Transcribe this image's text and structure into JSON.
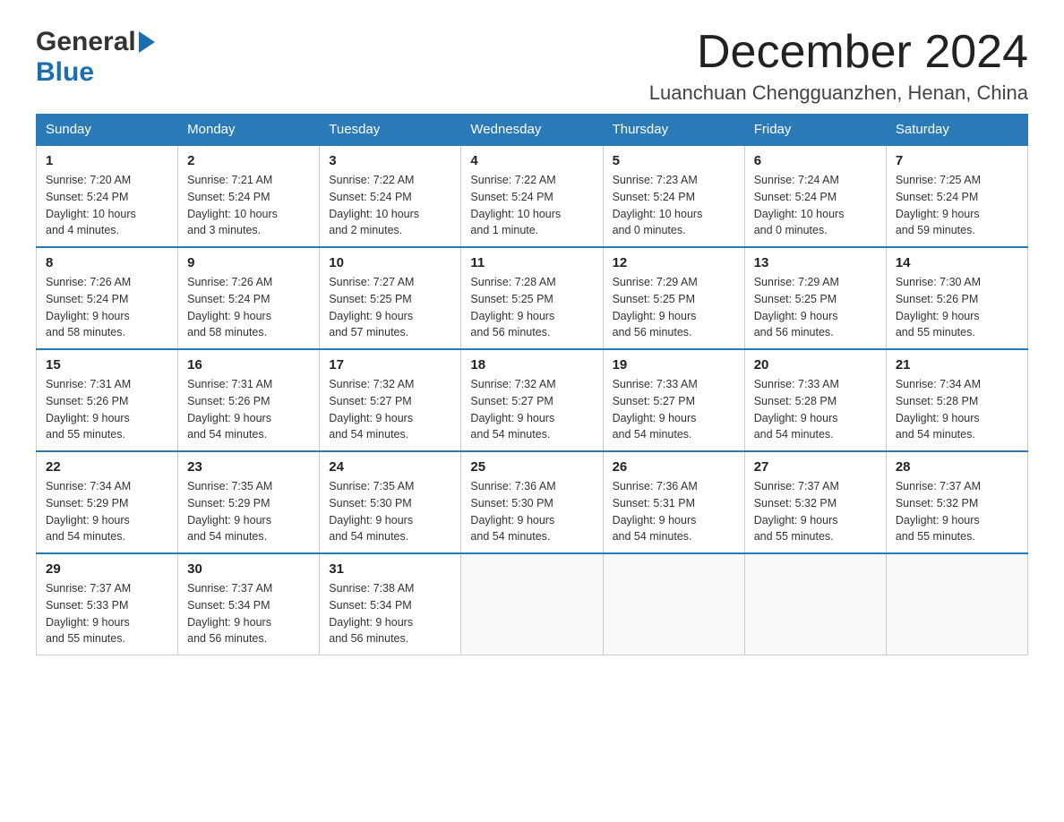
{
  "logo": {
    "general": "General",
    "blue": "Blue"
  },
  "header": {
    "month": "December 2024",
    "location": "Luanchuan Chengguanzhen, Henan, China"
  },
  "weekdays": [
    "Sunday",
    "Monday",
    "Tuesday",
    "Wednesday",
    "Thursday",
    "Friday",
    "Saturday"
  ],
  "weeks": [
    [
      {
        "day": "1",
        "info": "Sunrise: 7:20 AM\nSunset: 5:24 PM\nDaylight: 10 hours\nand 4 minutes."
      },
      {
        "day": "2",
        "info": "Sunrise: 7:21 AM\nSunset: 5:24 PM\nDaylight: 10 hours\nand 3 minutes."
      },
      {
        "day": "3",
        "info": "Sunrise: 7:22 AM\nSunset: 5:24 PM\nDaylight: 10 hours\nand 2 minutes."
      },
      {
        "day": "4",
        "info": "Sunrise: 7:22 AM\nSunset: 5:24 PM\nDaylight: 10 hours\nand 1 minute."
      },
      {
        "day": "5",
        "info": "Sunrise: 7:23 AM\nSunset: 5:24 PM\nDaylight: 10 hours\nand 0 minutes."
      },
      {
        "day": "6",
        "info": "Sunrise: 7:24 AM\nSunset: 5:24 PM\nDaylight: 10 hours\nand 0 minutes."
      },
      {
        "day": "7",
        "info": "Sunrise: 7:25 AM\nSunset: 5:24 PM\nDaylight: 9 hours\nand 59 minutes."
      }
    ],
    [
      {
        "day": "8",
        "info": "Sunrise: 7:26 AM\nSunset: 5:24 PM\nDaylight: 9 hours\nand 58 minutes."
      },
      {
        "day": "9",
        "info": "Sunrise: 7:26 AM\nSunset: 5:24 PM\nDaylight: 9 hours\nand 58 minutes."
      },
      {
        "day": "10",
        "info": "Sunrise: 7:27 AM\nSunset: 5:25 PM\nDaylight: 9 hours\nand 57 minutes."
      },
      {
        "day": "11",
        "info": "Sunrise: 7:28 AM\nSunset: 5:25 PM\nDaylight: 9 hours\nand 56 minutes."
      },
      {
        "day": "12",
        "info": "Sunrise: 7:29 AM\nSunset: 5:25 PM\nDaylight: 9 hours\nand 56 minutes."
      },
      {
        "day": "13",
        "info": "Sunrise: 7:29 AM\nSunset: 5:25 PM\nDaylight: 9 hours\nand 56 minutes."
      },
      {
        "day": "14",
        "info": "Sunrise: 7:30 AM\nSunset: 5:26 PM\nDaylight: 9 hours\nand 55 minutes."
      }
    ],
    [
      {
        "day": "15",
        "info": "Sunrise: 7:31 AM\nSunset: 5:26 PM\nDaylight: 9 hours\nand 55 minutes."
      },
      {
        "day": "16",
        "info": "Sunrise: 7:31 AM\nSunset: 5:26 PM\nDaylight: 9 hours\nand 54 minutes."
      },
      {
        "day": "17",
        "info": "Sunrise: 7:32 AM\nSunset: 5:27 PM\nDaylight: 9 hours\nand 54 minutes."
      },
      {
        "day": "18",
        "info": "Sunrise: 7:32 AM\nSunset: 5:27 PM\nDaylight: 9 hours\nand 54 minutes."
      },
      {
        "day": "19",
        "info": "Sunrise: 7:33 AM\nSunset: 5:27 PM\nDaylight: 9 hours\nand 54 minutes."
      },
      {
        "day": "20",
        "info": "Sunrise: 7:33 AM\nSunset: 5:28 PM\nDaylight: 9 hours\nand 54 minutes."
      },
      {
        "day": "21",
        "info": "Sunrise: 7:34 AM\nSunset: 5:28 PM\nDaylight: 9 hours\nand 54 minutes."
      }
    ],
    [
      {
        "day": "22",
        "info": "Sunrise: 7:34 AM\nSunset: 5:29 PM\nDaylight: 9 hours\nand 54 minutes."
      },
      {
        "day": "23",
        "info": "Sunrise: 7:35 AM\nSunset: 5:29 PM\nDaylight: 9 hours\nand 54 minutes."
      },
      {
        "day": "24",
        "info": "Sunrise: 7:35 AM\nSunset: 5:30 PM\nDaylight: 9 hours\nand 54 minutes."
      },
      {
        "day": "25",
        "info": "Sunrise: 7:36 AM\nSunset: 5:30 PM\nDaylight: 9 hours\nand 54 minutes."
      },
      {
        "day": "26",
        "info": "Sunrise: 7:36 AM\nSunset: 5:31 PM\nDaylight: 9 hours\nand 54 minutes."
      },
      {
        "day": "27",
        "info": "Sunrise: 7:37 AM\nSunset: 5:32 PM\nDaylight: 9 hours\nand 55 minutes."
      },
      {
        "day": "28",
        "info": "Sunrise: 7:37 AM\nSunset: 5:32 PM\nDaylight: 9 hours\nand 55 minutes."
      }
    ],
    [
      {
        "day": "29",
        "info": "Sunrise: 7:37 AM\nSunset: 5:33 PM\nDaylight: 9 hours\nand 55 minutes."
      },
      {
        "day": "30",
        "info": "Sunrise: 7:37 AM\nSunset: 5:34 PM\nDaylight: 9 hours\nand 56 minutes."
      },
      {
        "day": "31",
        "info": "Sunrise: 7:38 AM\nSunset: 5:34 PM\nDaylight: 9 hours\nand 56 minutes."
      },
      null,
      null,
      null,
      null
    ]
  ]
}
